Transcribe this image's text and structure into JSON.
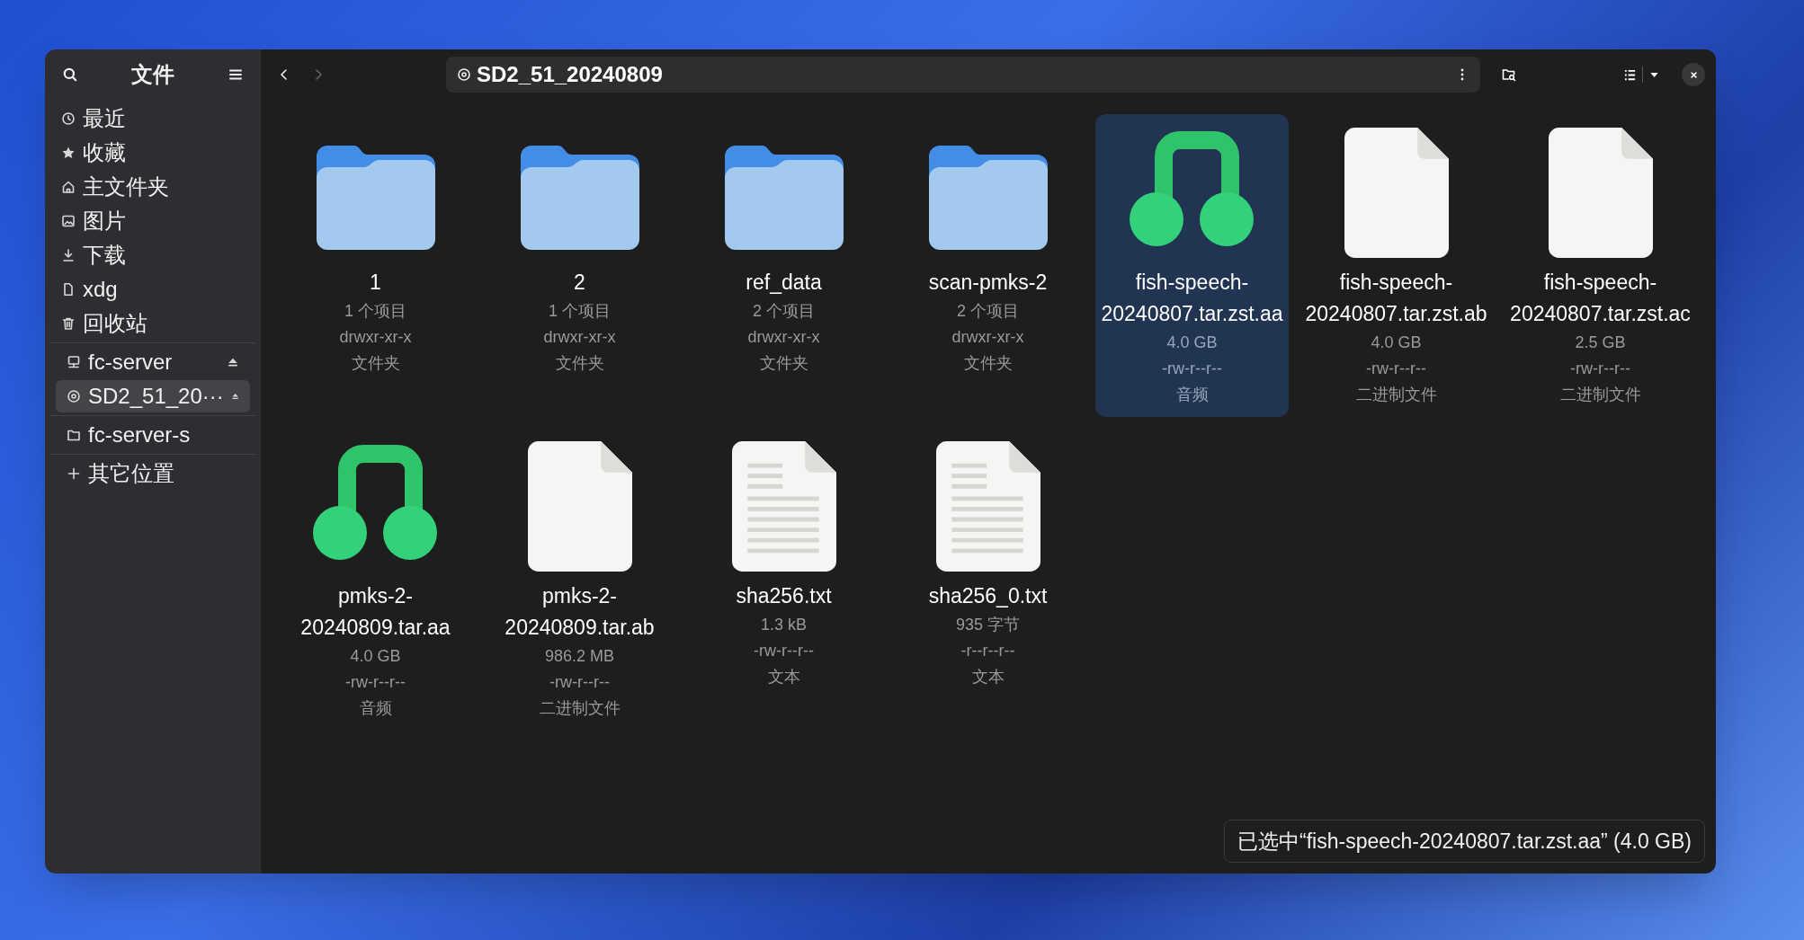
{
  "sidebar": {
    "title": "文件",
    "sections": [
      {
        "items": [
          {
            "label": "最近",
            "kind": "clock",
            "selected": false,
            "eject": false
          },
          {
            "label": "收藏",
            "kind": "star",
            "selected": false,
            "eject": false
          },
          {
            "label": "主文件夹",
            "kind": "home",
            "selected": false,
            "eject": false
          },
          {
            "label": "图片",
            "kind": "image",
            "selected": false,
            "eject": false
          },
          {
            "label": "下载",
            "kind": "download",
            "selected": false,
            "eject": false
          },
          {
            "label": "xdg",
            "kind": "file",
            "selected": false,
            "eject": false
          },
          {
            "label": "回收站",
            "kind": "trash",
            "selected": false,
            "eject": false
          }
        ]
      },
      {
        "items": [
          {
            "label": "fc-server",
            "kind": "server",
            "selected": false,
            "eject": true
          },
          {
            "label": "SD2_51_20···",
            "kind": "disc",
            "selected": true,
            "eject": true
          }
        ]
      },
      {
        "items": [
          {
            "label": "fc-server-s",
            "kind": "folder",
            "selected": false,
            "eject": false
          }
        ]
      },
      {
        "items": [
          {
            "label": "其它位置",
            "kind": "plus",
            "selected": false,
            "eject": false
          }
        ]
      }
    ]
  },
  "toolbar": {
    "path": "SD2_51_20240809",
    "back_disabled": false,
    "forward_disabled": true
  },
  "files": [
    {
      "name": "1",
      "kind": "folder",
      "selected": false,
      "details": [
        "1 个项目",
        "drwxr-xr-x",
        "文件夹"
      ]
    },
    {
      "name": "2",
      "kind": "folder",
      "selected": false,
      "details": [
        "1 个项目",
        "drwxr-xr-x",
        "文件夹"
      ]
    },
    {
      "name": "ref_data",
      "kind": "folder",
      "selected": false,
      "details": [
        "2 个项目",
        "drwxr-xr-x",
        "文件夹"
      ]
    },
    {
      "name": "scan-pmks-2",
      "kind": "folder",
      "selected": false,
      "details": [
        "2 个项目",
        "drwxr-xr-x",
        "文件夹"
      ]
    },
    {
      "name": "fish-speech-20240807.tar.zst.aa",
      "kind": "audio",
      "selected": true,
      "details": [
        "4.0 GB",
        "-rw-r--r--",
        "音频"
      ]
    },
    {
      "name": "fish-speech-20240807.tar.zst.ab",
      "kind": "binary",
      "selected": false,
      "details": [
        "4.0 GB",
        "-rw-r--r--",
        "二进制文件"
      ]
    },
    {
      "name": "fish-speech-20240807.tar.zst.ac",
      "kind": "binary",
      "selected": false,
      "details": [
        "2.5 GB",
        "-rw-r--r--",
        "二进制文件"
      ]
    },
    {
      "name": "pmks-2-20240809.tar.aa",
      "kind": "audio",
      "selected": false,
      "details": [
        "4.0 GB",
        "-rw-r--r--",
        "音频"
      ]
    },
    {
      "name": "pmks-2-20240809.tar.ab",
      "kind": "binary",
      "selected": false,
      "details": [
        "986.2 MB",
        "-rw-r--r--",
        "二进制文件"
      ]
    },
    {
      "name": "sha256.txt",
      "kind": "text",
      "selected": false,
      "details": [
        "1.3 kB",
        "-rw-r--r--",
        "文本"
      ]
    },
    {
      "name": "sha256_0.txt",
      "kind": "text",
      "selected": false,
      "details": [
        "935 字节",
        "-r--r--r--",
        "文本"
      ]
    }
  ],
  "status_bar": "已选中“fish-speech-20240807.tar.zst.aa” (4.0 GB)"
}
